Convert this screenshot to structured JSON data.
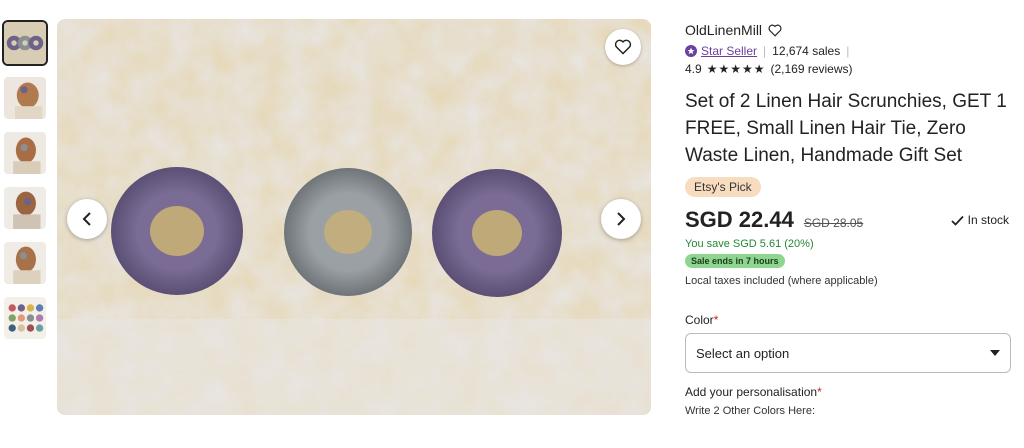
{
  "gallery": {
    "thumbnails": [
      {
        "name": "thumb-scrunchies-trio"
      },
      {
        "name": "thumb-model-1"
      },
      {
        "name": "thumb-model-2"
      },
      {
        "name": "thumb-model-3"
      },
      {
        "name": "thumb-model-4"
      },
      {
        "name": "thumb-color-swatches"
      }
    ],
    "favorite_icon": "heart-icon",
    "prev_icon": "chevron-left-icon",
    "next_icon": "chevron-right-icon"
  },
  "shop": {
    "name": "OldLinenMill",
    "star_seller": "Star Seller",
    "sales": "12,674 sales",
    "rating": "4.9",
    "stars": "★★★★★",
    "reviews": "(2,169 reviews)"
  },
  "product": {
    "title": "Set of 2 Linen Hair Scrunchies, GET 1 FREE, Small Linen Hair Tie, Zero Waste Linen, Handmade Gift Set",
    "badge": "Etsy's Pick",
    "price": "SGD 22.44",
    "old_price": "SGD 28.05",
    "stock": "In stock",
    "savings": "You save SGD 5.61 (20%)",
    "sale_ends": "Sale ends in 7 hours",
    "tax_note": "Local taxes included (where applicable)"
  },
  "options": {
    "color_label": "Color",
    "required_mark": "*",
    "select_value": "Select an option",
    "personalisation_label": "Add your personalisation",
    "write_prompt": "Write 2 Other Colors Here:"
  },
  "colors": {
    "purple": "#6e6288",
    "gray": "#8a8f93",
    "star_seller": "#6b3fa0",
    "savings": "#258635",
    "sale_badge": "#8ed58f",
    "pick_badge": "#f8dcc0"
  }
}
